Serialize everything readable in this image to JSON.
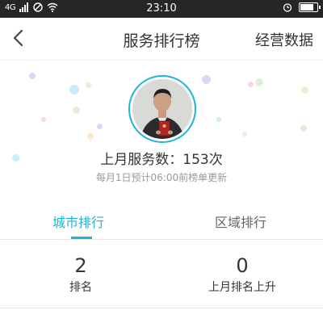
{
  "status_bar": {
    "signal": "4G",
    "time": "23:10"
  },
  "nav": {
    "title": "服务排行榜",
    "right_action": "经营数据"
  },
  "profile": {
    "service_count_text": "上月服务数：153次",
    "update_note": "每月1日预计06:00前榜单更新"
  },
  "tabs": [
    {
      "label": "城市排行",
      "active": true
    },
    {
      "label": "区域排行",
      "active": false
    }
  ],
  "stats": [
    {
      "value": "2",
      "label": "排名"
    },
    {
      "value": "0",
      "label": "上月排名上升"
    }
  ],
  "colors": {
    "accent": "#1fb5d6",
    "status_bar": "#262626"
  },
  "icons": {
    "back": "chevron-left-icon",
    "alarm": "alarm-icon",
    "battery": "battery-icon",
    "wifi": "wifi-icon"
  }
}
